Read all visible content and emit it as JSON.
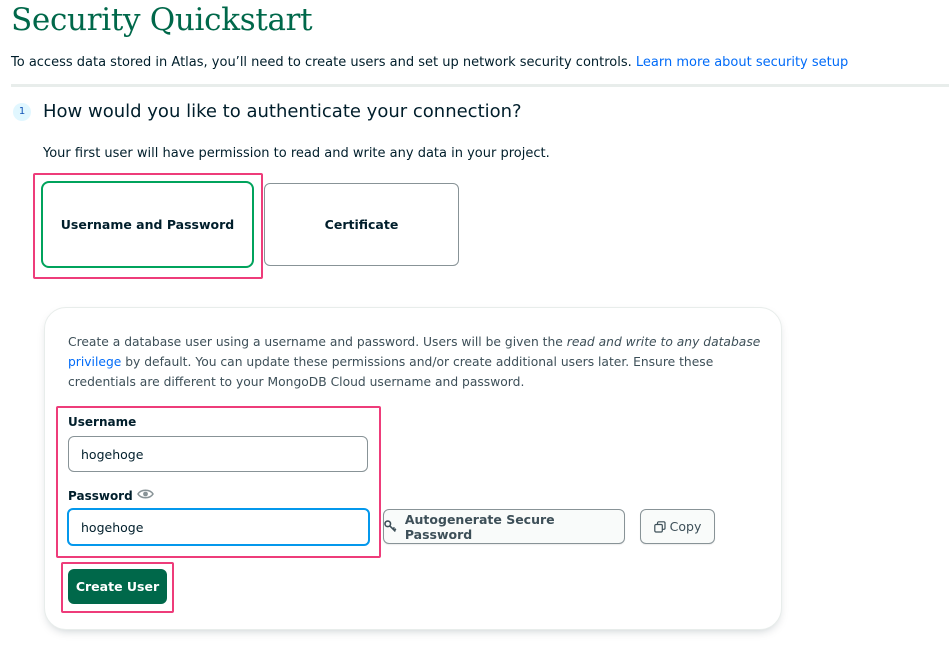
{
  "page": {
    "title": "Security Quickstart",
    "intro": "To access data stored in Atlas, you’ll need to create users and set up network security controls.",
    "intro_link": "Learn more about security setup"
  },
  "step1": {
    "number": "1",
    "heading": "How would you like to authenticate your connection?",
    "subtext": "Your first user will have permission to read and write any data in your project.",
    "options": [
      {
        "label": "Username and Password",
        "selected": true
      },
      {
        "label": "Certificate",
        "selected": false
      }
    ]
  },
  "panel": {
    "desc_part1": "Create a database user using a username and password. Users will be given the ",
    "desc_emph": "read and write to any database",
    "desc_link": "privilege",
    "desc_part2": " by default. You can update these permissions and/or create additional users later. Ensure these credentials are different to your MongoDB Cloud username and password.",
    "username_label": "Username",
    "username_value": "hogehoge",
    "password_label": "Password",
    "password_value": "hogehoge",
    "autogen_label": "Autogenerate Secure Password",
    "copy_label": "Copy",
    "create_label": "Create User"
  },
  "colors": {
    "brand_green": "#00684a",
    "selected_border": "#00a35c",
    "highlight": "#ee3c7a",
    "focus_blue": "#0498ec",
    "link_blue": "#016bf8"
  }
}
